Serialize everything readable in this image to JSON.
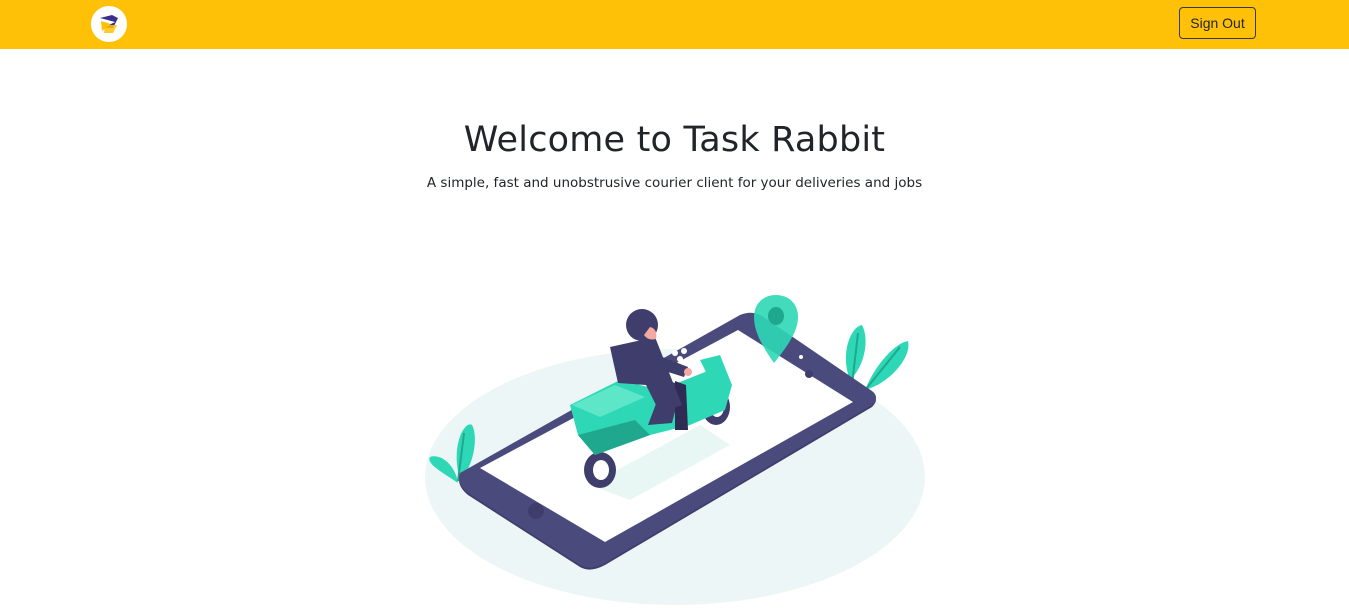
{
  "navbar": {
    "logo_icon": "rabbit-logo-icon",
    "sign_out_label": "Sign Out",
    "background_color": "#ffc107"
  },
  "hero": {
    "title": "Welcome to Task Rabbit",
    "subtitle": "A simple, fast and unobstrusive courier client for your deliveries and jobs"
  },
  "illustration": {
    "icon": "scooter-delivery-phone-illustration",
    "colors": {
      "phone": "#4a4a7c",
      "accent": "#2ed8b6",
      "backdrop": "#edf6f7"
    }
  }
}
